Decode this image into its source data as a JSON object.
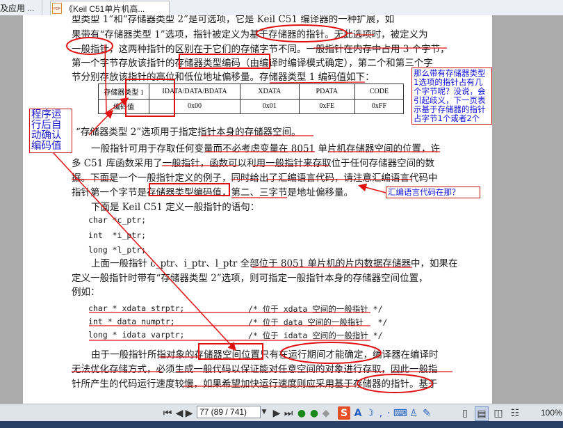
{
  "tabs": [
    {
      "label": "及应用 ..."
    },
    {
      "label": "《Keil C51单片机高...",
      "icon": "pdf-file-icon"
    }
  ],
  "doc": {
    "lines": [
      "型类型 1”和“存储器类型 2”是可选项，它是 Keil C51 编译器的一种扩展，如",
      "果带有“存储器类型 1”选项，指针被定义为基于存储器的指针。无此选项时，被定义为",
      "一般指针，这两种指针的区别在于它们的存储字节不同。一般指针在内存中占用 3 个字节，",
      "第一个字节存放该指针的存储器类型编码（由编译时编译模式确定），第二个和第三个字",
      "节分别存放该指针的高位和低位地址偏移量。存储器类型 1 编码值如下：",
      "“存储器类型 2”选项用于指定指针本身的存储器空间。",
      "一般指针可用于存取任何变量而不必考虑变量在 8051 单片机存储器空间的位置，许",
      "多 C51 库函数采用了一般指针，函数可以利用一般指针来存取位于任何存储器空间的数",
      "据。下面是一个一般指针定义的例子，同时给出了汇编语言代码，请注意汇编语言代码中",
      "指针第一个字节是存储器类型编码值，第二、三字节是地址偏移量。",
      "下面是 Keil C51 定义一般指针的语句：",
      "上面一般指针 c_ptr、i_ptr、l_ptr 全部位于 8051 单片机的片内数据存储器中，如果在",
      "定义一般指针时带有“存储器类型 2”选项，则可指定一般指针本身的存储器空间位置，",
      "例如：",
      "由于一般指针所指对象的存储器空间位置只有在运行期间才能确定，编译器在编译时",
      "无法优化存储方式，必须生成一般代码以保证能对任意空间的对象进行存取，因此一般指",
      "针所产生的代码运行速度较慢，如果希望加快运行速度则应采用基于存储器的指针。基于"
    ],
    "code1": [
      "char *c_ptr;",
      "int  *i_ptr;",
      "long *l_ptr;"
    ],
    "code2": [
      {
        "decl": "char * xdata strptr;",
        "comment": "/* 位于 xdata 空间的一般指针 */"
      },
      {
        "decl": "int * data numptr;",
        "comment": "/* 位于 data 空间的一般指针   */"
      },
      {
        "decl": "long * idata varptr;",
        "comment": "/* 位于 idata 空间的一般指针 */"
      }
    ],
    "table": {
      "headers": [
        "存储器类型 1",
        "IDATA/DATA/BDATA",
        "XDATA",
        "PDATA",
        "CODE"
      ],
      "row": [
        "编码值",
        "0x00",
        "0x01",
        "0xFE",
        "0xFF"
      ]
    }
  },
  "notes": {
    "left": "程序运行后自动确认编码值",
    "right": "那么带有存储器类型1选项的指针占有几个字节呢？没说，会引起歧义，下一页表示基于存储器的指针占字节1个或者2个",
    "middle": "汇编语言代码在那？"
  },
  "toolbar": {
    "page_field": "77 (89 / 741)",
    "zoom": "100%"
  },
  "colors": {
    "annotation_red": "#e01010",
    "note_text_blue": "#1010e0"
  }
}
